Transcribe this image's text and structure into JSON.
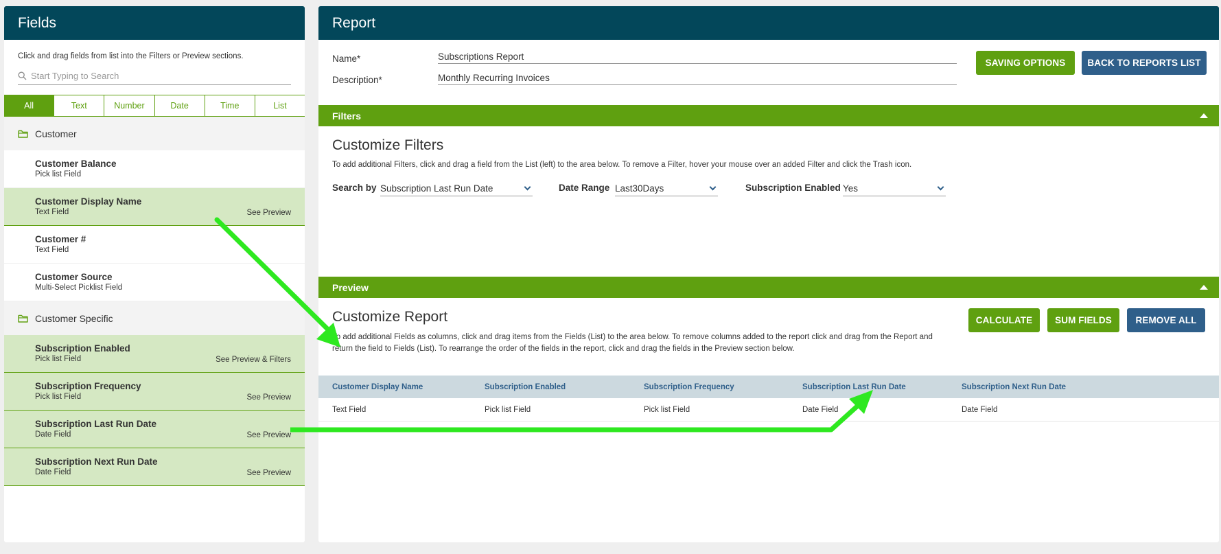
{
  "fields_panel": {
    "title": "Fields",
    "instructions": "Click and drag fields from list into the Filters or Preview sections.",
    "search_placeholder": "Start Typing to Search",
    "tabs": [
      "All",
      "Text",
      "Number",
      "Date",
      "Time",
      "List"
    ],
    "active_tab": "All",
    "groups": [
      {
        "name": "Customer",
        "fields": [
          {
            "name": "Customer Balance",
            "type": "Pick list Field",
            "preview": "",
            "selected": false
          },
          {
            "name": "Customer Display Name",
            "type": "Text Field",
            "preview": "See Preview",
            "selected": true
          },
          {
            "name": "Customer #",
            "type": "Text Field",
            "preview": "",
            "selected": false
          },
          {
            "name": "Customer Source",
            "type": "Multi-Select Picklist Field",
            "preview": "",
            "selected": false
          }
        ]
      },
      {
        "name": "Customer Specific",
        "fields": [
          {
            "name": "Subscription Enabled",
            "type": "Pick list Field",
            "preview": "See Preview & Filters",
            "selected": true
          },
          {
            "name": "Subscription Frequency",
            "type": "Pick list Field",
            "preview": "See Preview",
            "selected": true
          },
          {
            "name": "Subscription Last Run Date",
            "type": "Date Field",
            "preview": "See Preview",
            "selected": true
          },
          {
            "name": "Subscription Next Run Date",
            "type": "Date Field",
            "preview": "See Preview",
            "selected": true
          }
        ]
      }
    ]
  },
  "report": {
    "title": "Report",
    "name_label": "Name*",
    "name_value": "Subscriptions Report",
    "description_label": "Description*",
    "description_value": "Monthly Recurring Invoices",
    "saving_options_label": "SAVING OPTIONS",
    "back_label": "BACK TO REPORTS LIST"
  },
  "filters": {
    "bar_label": "Filters",
    "title": "Customize Filters",
    "description": "To add additional Filters, click and drag a field from the List (left) to the area below. To remove a Filter, hover your mouse over an added Filter and click the Trash icon.",
    "search_by_label": "Search by",
    "search_by_value": "Subscription Last Run Date",
    "date_range_label": "Date Range",
    "date_range_value": "Last30Days",
    "sub_enabled_label": "Subscription Enabled",
    "sub_enabled_value": "Yes"
  },
  "preview": {
    "bar_label": "Preview",
    "title": "Customize Report",
    "description": "To add additional Fields as columns, click and drag items from the Fields (List) to the area below. To remove columns added to the report click and drag from the Report and return the field to Fields (List). To rearrange the order of the fields in the report, click and drag the fields in the Preview section below.",
    "calculate_label": "CALCULATE",
    "sum_fields_label": "SUM FIELDS",
    "remove_all_label": "REMOVE ALL",
    "columns": [
      "Customer Display Name",
      "Subscription Enabled",
      "Subscription Frequency",
      "Subscription Last Run Date",
      "Subscription Next Run Date"
    ],
    "row": [
      "Text Field",
      "Pick list Field",
      "Pick list Field",
      "Date Field",
      "Date Field"
    ]
  },
  "colors": {
    "header": "#03475a",
    "green": "#5fa010",
    "blue": "#2f5f8a",
    "selected_row": "#d5e8c3",
    "arrow": "#2ee820"
  }
}
